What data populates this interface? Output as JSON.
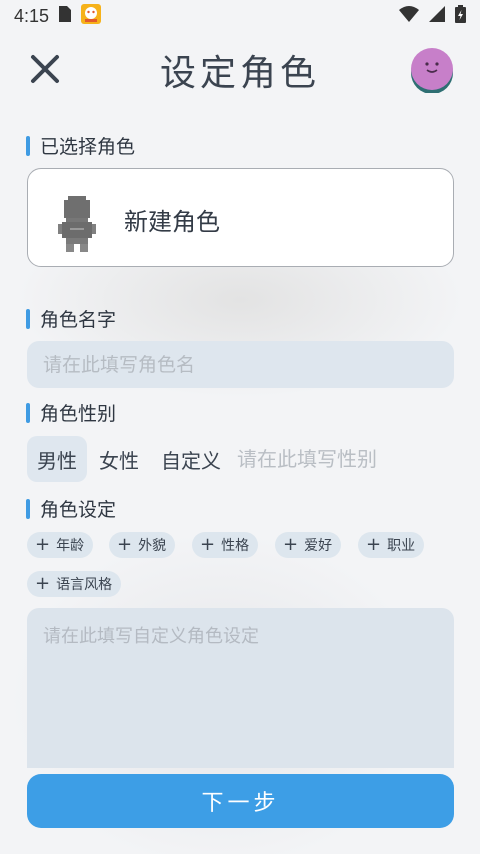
{
  "status_bar": {
    "time": "4:15",
    "icons": [
      "sim-card-icon",
      "app-notification-icon",
      "wifi-icon",
      "signal-icon",
      "battery-icon"
    ]
  },
  "header": {
    "title": "设定角色",
    "close_icon": "close-icon",
    "avatar_icon": "smiley-avatar"
  },
  "selected_role": {
    "heading": "已选择角色",
    "name": "新建角色"
  },
  "role_name": {
    "heading": "角色名字",
    "placeholder": "请在此填写角色名",
    "value": ""
  },
  "gender": {
    "heading": "角色性别",
    "options": [
      "男性",
      "女性",
      "自定义"
    ],
    "selected": "男性",
    "custom_placeholder": "请在此填写性别"
  },
  "settings": {
    "heading": "角色设定",
    "tags": [
      "年龄",
      "外貌",
      "性格",
      "爱好",
      "职业",
      "语言风格"
    ],
    "placeholder": "请在此填写自定义角色设定"
  },
  "actions": {
    "next_label": "下一步"
  },
  "colors": {
    "accent": "#3d9ee6",
    "input_bg": "#dee6ee",
    "avatar": "#c77fc9"
  }
}
